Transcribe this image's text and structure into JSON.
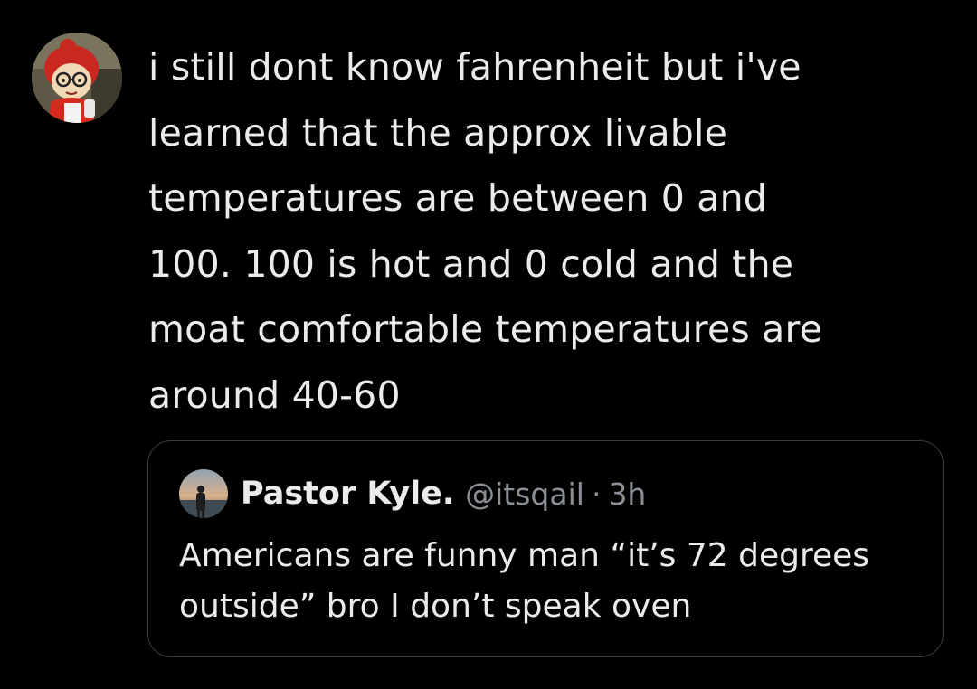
{
  "post": {
    "avatar_icon": "profile-avatar-cartoon-girl-icon",
    "text_lines": [
      "i still dont know fahrenheit but i've",
      "learned that the approx livable",
      "temperatures are between 0 and",
      "100. 100 is hot and 0 cold and the",
      "moat comfortable temperatures are",
      "around 40-60"
    ]
  },
  "quote": {
    "avatar_icon": "profile-avatar-photo-icon",
    "display_name": "Pastor Kyle.",
    "handle": "@itsqail",
    "separator": "·",
    "time": "3h",
    "text_lines": [
      "Americans are funny man “it’s 72 degrees",
      "outside” bro I don’t speak oven"
    ]
  },
  "colors": {
    "background": "#000000",
    "text": "#ebebeb",
    "muted": "#8b9096",
    "border": "#3a3d41"
  }
}
